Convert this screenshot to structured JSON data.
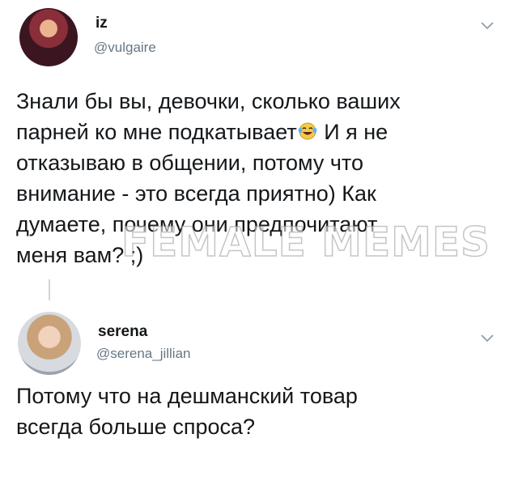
{
  "tweets": [
    {
      "display_name": "iz",
      "handle": "@vulgaire",
      "text_part1": "Знали бы вы, девочки, сколько ваших\nпарней ко мне подкатывает",
      "emoji": "face-with-tears-of-joy-icon",
      "text_part2": " И я не\nотказываю в общении, потому что\nвнимание - это всегда приятно) Как\nдумаете, почему они предпочитают\nменя вам? ;)"
    },
    {
      "display_name": "serena",
      "handle": "@serena_jillian",
      "text": "Потому что на дешманский товар\nвсегда больше спроса?"
    }
  ],
  "watermark": "FEMALE MEMES",
  "colors": {
    "text": "#14171a",
    "secondary": "#657786",
    "thread_line": "#ccd6dd"
  }
}
